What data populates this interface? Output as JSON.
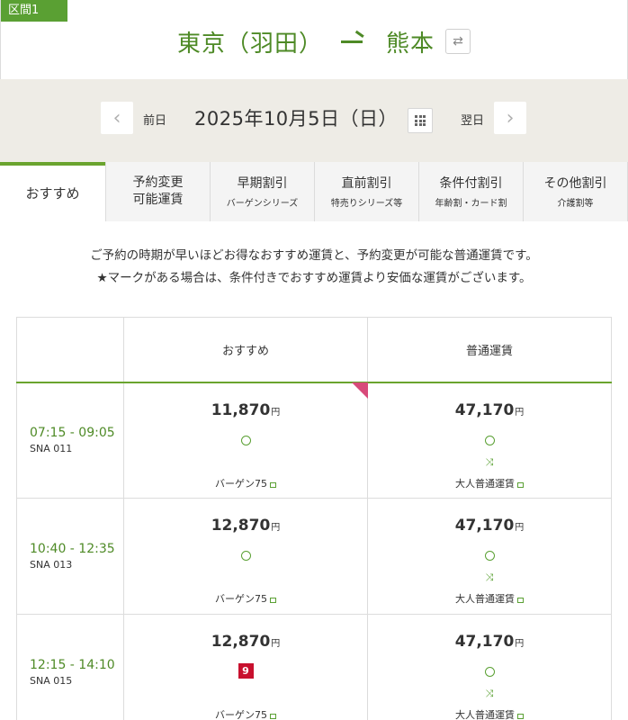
{
  "route": {
    "section_tag": "区間1",
    "from": "東京（羽田）",
    "to": "熊本",
    "swap_icon": "swap-arrows-icon"
  },
  "date_nav": {
    "prev_label": "前日",
    "next_label": "翌日",
    "date": "2025年10月5日（日）",
    "prev_icon": "chevron-left-icon",
    "next_icon": "chevron-right-icon",
    "calendar_icon": "calendar-grid-icon"
  },
  "tabs": [
    {
      "title": "おすすめ",
      "sub": ""
    },
    {
      "title": "予約変更\n可能運賃",
      "sub": ""
    },
    {
      "title": "早期割引",
      "sub": "バーゲンシリーズ"
    },
    {
      "title": "直前割引",
      "sub": "特売りシリーズ等"
    },
    {
      "title": "条件付割引",
      "sub": "年齢割・カード割"
    },
    {
      "title": "その他割引",
      "sub": "介護割等"
    }
  ],
  "intro": {
    "line1": "ご予約の時期が早いほどお得なおすすめ運賃と、予約変更が可能な普通運賃です。",
    "line2": "★マークがある場合は、条件付きでおすすめ運賃より安価な運賃がございます。"
  },
  "table": {
    "headers": {
      "recommended": "おすすめ",
      "regular": "普通運賃"
    },
    "yen": "円",
    "rows": [
      {
        "time": "07:15 - 09:05",
        "flight": "SNA 011",
        "rec_price": "11,870",
        "rec_fare": "バーゲン75",
        "rec_seats": "",
        "reg_price": "47,170",
        "reg_fare": "大人普通運賃"
      },
      {
        "time": "10:40 - 12:35",
        "flight": "SNA 013",
        "rec_price": "12,870",
        "rec_fare": "バーゲン75",
        "rec_seats": "",
        "reg_price": "47,170",
        "reg_fare": "大人普通運賃"
      },
      {
        "time": "12:15 - 14:10",
        "flight": "SNA 015",
        "rec_price": "12,870",
        "rec_fare": "バーゲン75",
        "rec_seats": "9",
        "reg_price": "47,170",
        "reg_fare": "大人普通運賃"
      }
    ]
  },
  "colors": {
    "accent_green": "#5aa033",
    "route_green": "#4e8a26",
    "seat_red": "#c8102e",
    "corner_pink": "#d84a7a"
  }
}
